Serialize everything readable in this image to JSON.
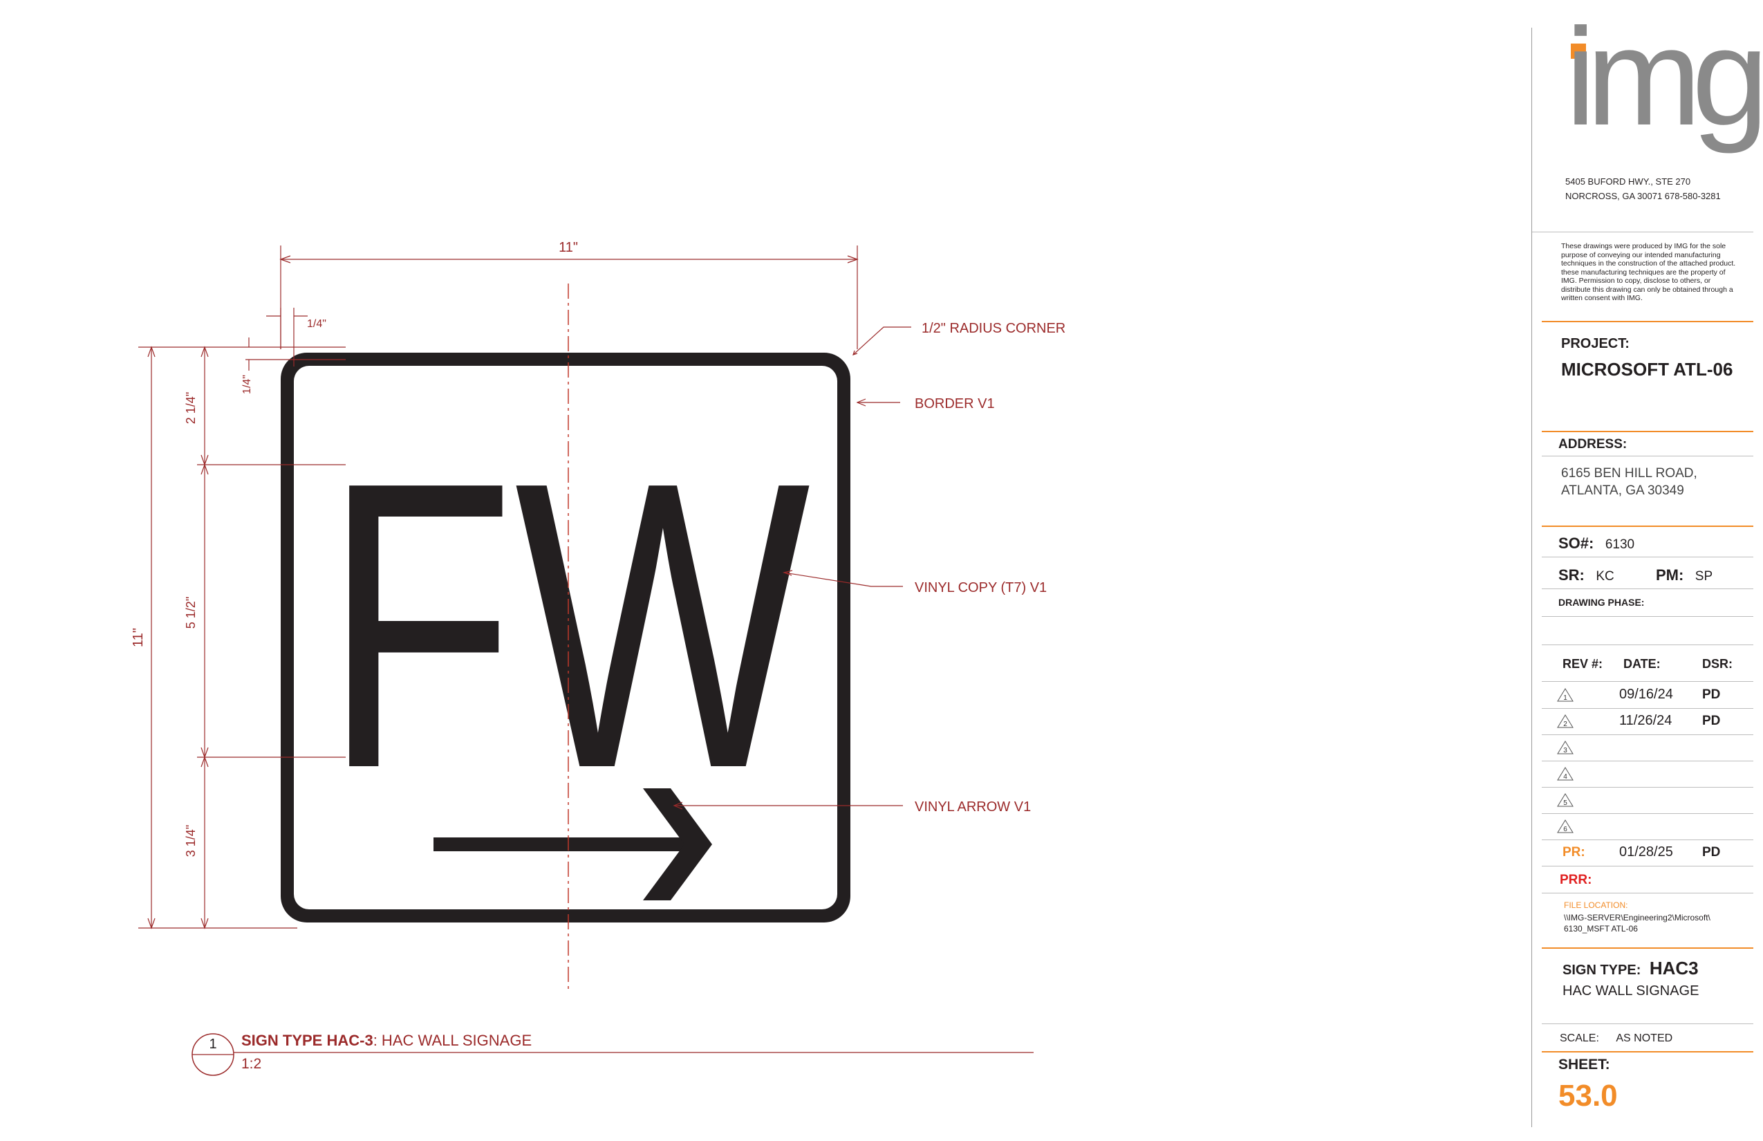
{
  "detail": {
    "number": "1",
    "title_bold": "SIGN TYPE HAC-3",
    "title_rest": ": HAC WALL SIGNAGE",
    "scale": "1:2"
  },
  "sign": {
    "copy": "FW",
    "arrow_direction": "right",
    "fill_color": "#231f20"
  },
  "dimensions": {
    "overall_width": "11\"",
    "overall_height": "11\"",
    "border_offset_h": "1/4\"",
    "border_offset_v": "1/4\"",
    "top_space": "2 1/4\"",
    "letter_height": "5 1/2\"",
    "bottom_space": "3 1/4\""
  },
  "callouts": {
    "corner": "1/2\" RADIUS CORNER",
    "border": "BORDER V1",
    "copy": "VINYL COPY (T7) V1",
    "arrow": "VINYL ARROW V1"
  },
  "colors": {
    "dimension": "#9b2a2a",
    "accent_orange": "#f28c28",
    "accent_red": "#e02020",
    "logo_grey": "#8a8a8a"
  },
  "titleblock": {
    "logo_text": "img",
    "address_line1": "5405 BUFORD HWY., STE 270",
    "address_line2": "NORCROSS, GA 30071   678-580-3281",
    "disclaimer": "These drawings were produced by IMG for the sole purpose of conveying our intended manufacturing techniques in the construction of the attached product. these manufacturing techniques are the property of IMG. Permission to copy, disclose to others, or distribute this drawing can only be obtained through a written consent with IMG.",
    "project_label": "PROJECT:",
    "project_name": "MICROSOFT ATL-06",
    "address_label": "ADDRESS:",
    "site_address_line1": "6165 BEN HILL ROAD,",
    "site_address_line2": "ATLANTA, GA 30349",
    "so_label": "SO#:",
    "so_value": "6130",
    "sr_label": "SR:",
    "sr_value": "KC",
    "pm_label": "PM:",
    "pm_value": "SP",
    "phase_label": "DRAWING PHASE:",
    "rev_header": {
      "rev": "REV #:",
      "date": "DATE:",
      "dsr": "DSR:"
    },
    "revisions": [
      {
        "num": "1",
        "date": "09/16/24",
        "dsr": "PD"
      },
      {
        "num": "2",
        "date": "11/26/24",
        "dsr": "PD"
      },
      {
        "num": "3",
        "date": "",
        "dsr": ""
      },
      {
        "num": "4",
        "date": "",
        "dsr": ""
      },
      {
        "num": "5",
        "date": "",
        "dsr": ""
      },
      {
        "num": "6",
        "date": "",
        "dsr": ""
      }
    ],
    "pr_label": "PR:",
    "pr_date": "01/28/25",
    "pr_dsr": "PD",
    "prr_label": "PRR:",
    "file_location_label": "FILE LOCATION:",
    "file_location_line1": "\\\\IMG-SERVER\\Engineering2\\Microsoft\\",
    "file_location_line2": "6130_MSFT ATL-06",
    "sign_type_label": "SIGN TYPE:",
    "sign_type_value": "HAC3",
    "sign_type_desc": "HAC WALL SIGNAGE",
    "scale_label": "SCALE:",
    "scale_value": "AS NOTED",
    "sheet_label": "SHEET:",
    "sheet_value": "53.0"
  }
}
